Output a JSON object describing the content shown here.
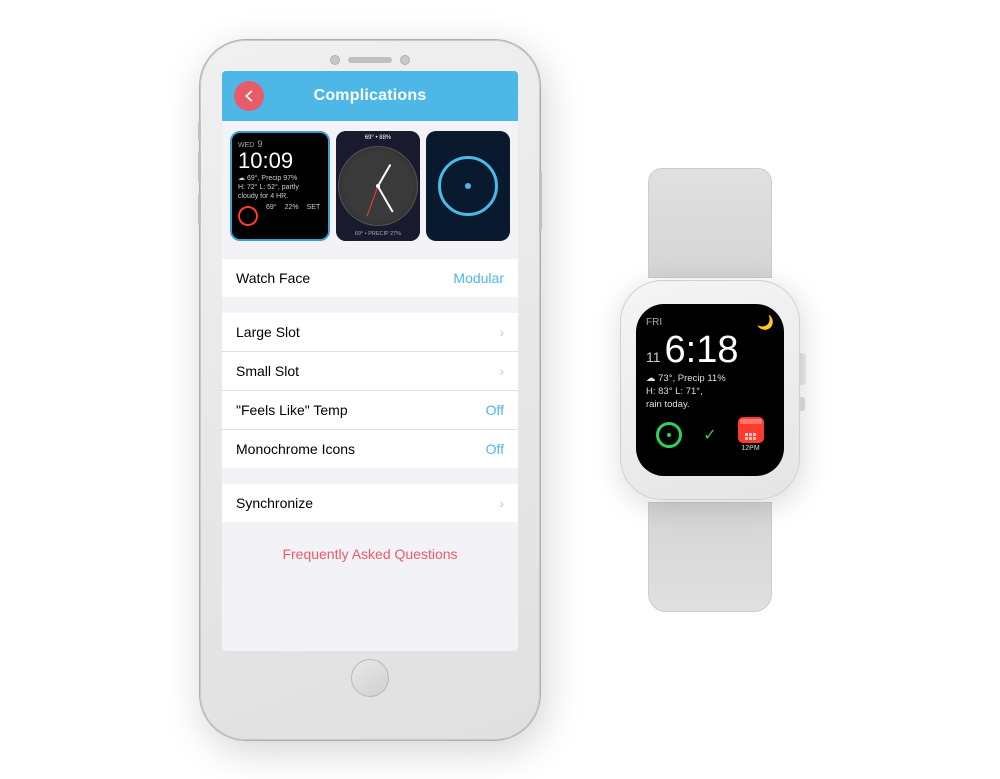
{
  "iphone": {
    "nav": {
      "title": "Complications",
      "back_icon": "←"
    },
    "previews": {
      "card1": {
        "day": "WED",
        "num": "9",
        "time": "10:09",
        "weather": "69°, Precip 97%",
        "detail": "H: 72° L: 52°, partly",
        "detail2": "cloudy for 4 HR.",
        "temp": "69°",
        "pct": "22%",
        "label": "SET"
      },
      "card2": {
        "temp": "69° • 88%",
        "bottom": "69° • PRECIP 27%"
      },
      "card3": {}
    },
    "settings": {
      "watch_face_label": "Watch Face",
      "watch_face_value": "Modular",
      "large_slot_label": "Large Slot",
      "small_slot_label": "Small Slot",
      "feels_like_label": "\"Feels Like\" Temp",
      "feels_like_value": "Off",
      "monochrome_label": "Monochrome Icons",
      "monochrome_value": "Off",
      "synchronize_label": "Synchronize"
    },
    "faq": {
      "label": "Frequently Asked Questions"
    }
  },
  "watch": {
    "day_label": "FRI",
    "day_num": "11",
    "time": "6:18",
    "moon_icon": "🌙",
    "weather_line1": "73°, Precip 11%",
    "weather_line2": "H: 83° L: 71°,",
    "weather_line3": "rain today.",
    "cal_label": "12PM",
    "colors": {
      "accent": "#4db8e8",
      "back_btn": "#e85c6a",
      "faq": "#e85c6a",
      "ring": "#30d158"
    }
  }
}
